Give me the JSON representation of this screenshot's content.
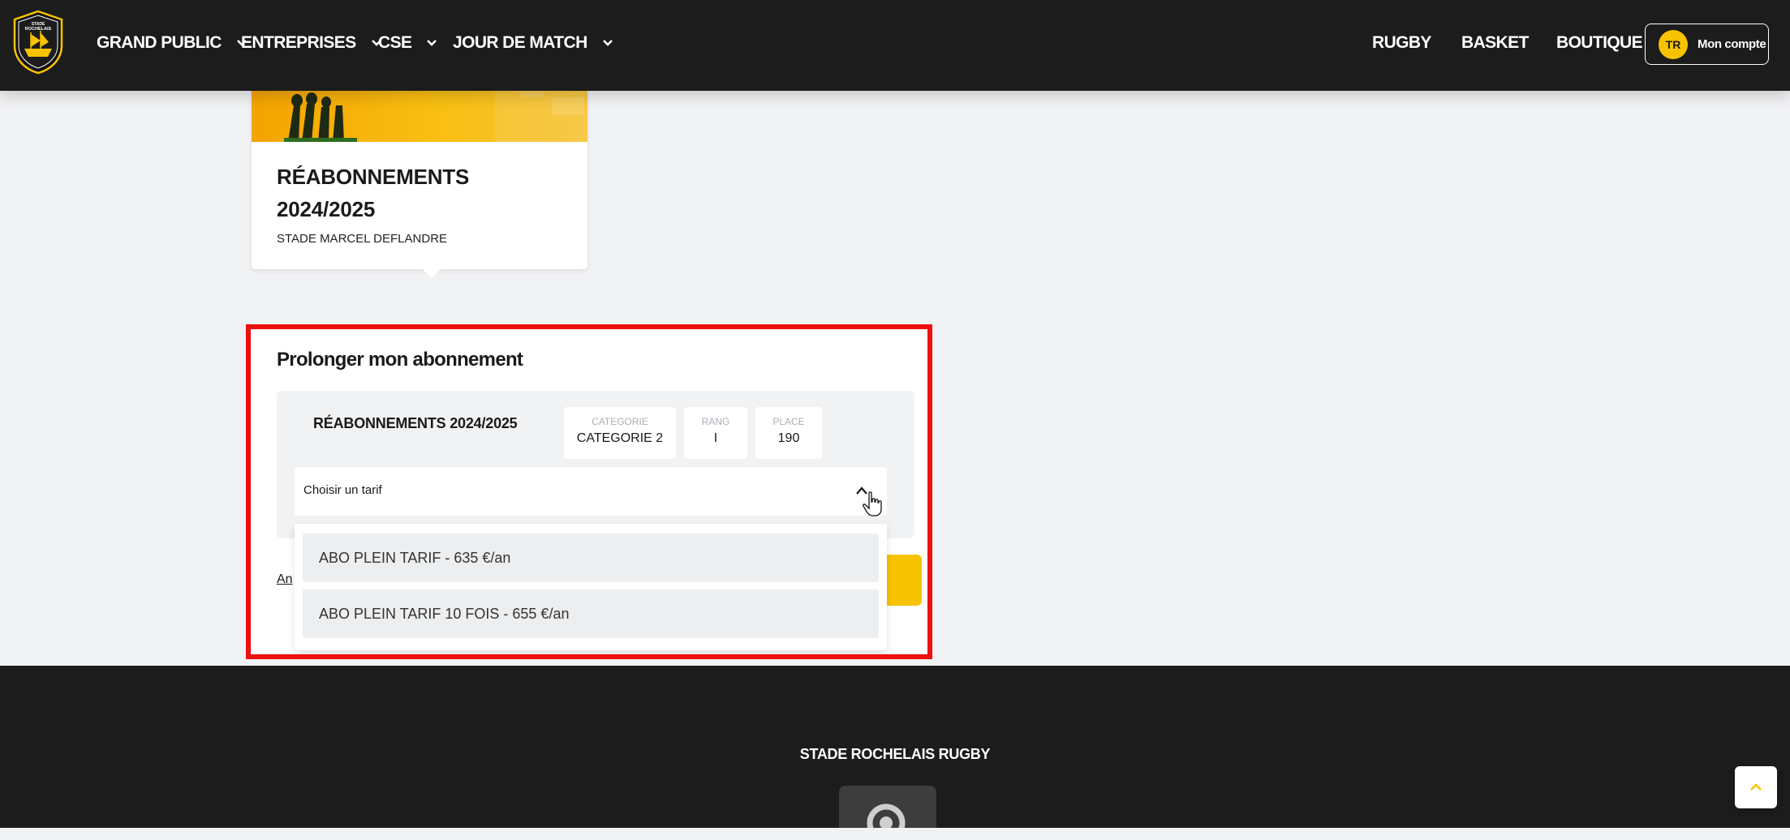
{
  "header": {
    "logo_text": [
      "STADE",
      "ROCHELAIS"
    ],
    "nav": [
      {
        "label": "GRAND PUBLIC"
      },
      {
        "label": "ENTREPRISES"
      },
      {
        "label": "CSE"
      },
      {
        "label": "JOUR DE MATCH"
      }
    ],
    "links": [
      {
        "label": "RUGBY"
      },
      {
        "label": "BASKET"
      },
      {
        "label": "BOUTIQUE"
      }
    ],
    "account": {
      "initials": "TR",
      "label": "Mon compte"
    }
  },
  "card": {
    "title": "RÉABONNEMENTS 2024/2025",
    "subtitle": "STADE MARCEL DEFLANDRE"
  },
  "panel": {
    "title": "Prolonger mon abonnement",
    "subscription_name": "RÉABONNEMENTS 2024/2025",
    "info": [
      {
        "label": "CATEGORIE",
        "value": "CATEGORIE 2"
      },
      {
        "label": "RANG",
        "value": "I"
      },
      {
        "label": "PLACE",
        "value": "190"
      }
    ],
    "select_placeholder": "Choisir un tarif",
    "options": [
      {
        "label": "ABO PLEIN TARIF - 635 €/an"
      },
      {
        "label": "ABO PLEIN TARIF 10 FOIS - 655 €/an"
      }
    ],
    "cancel_label": "An"
  },
  "footer": {
    "title": "STADE ROCHELAIS RUGBY"
  },
  "colors": {
    "accent": "#f7c300",
    "header_bg": "#1c1c1c",
    "highlight": "#ee0f0f"
  }
}
